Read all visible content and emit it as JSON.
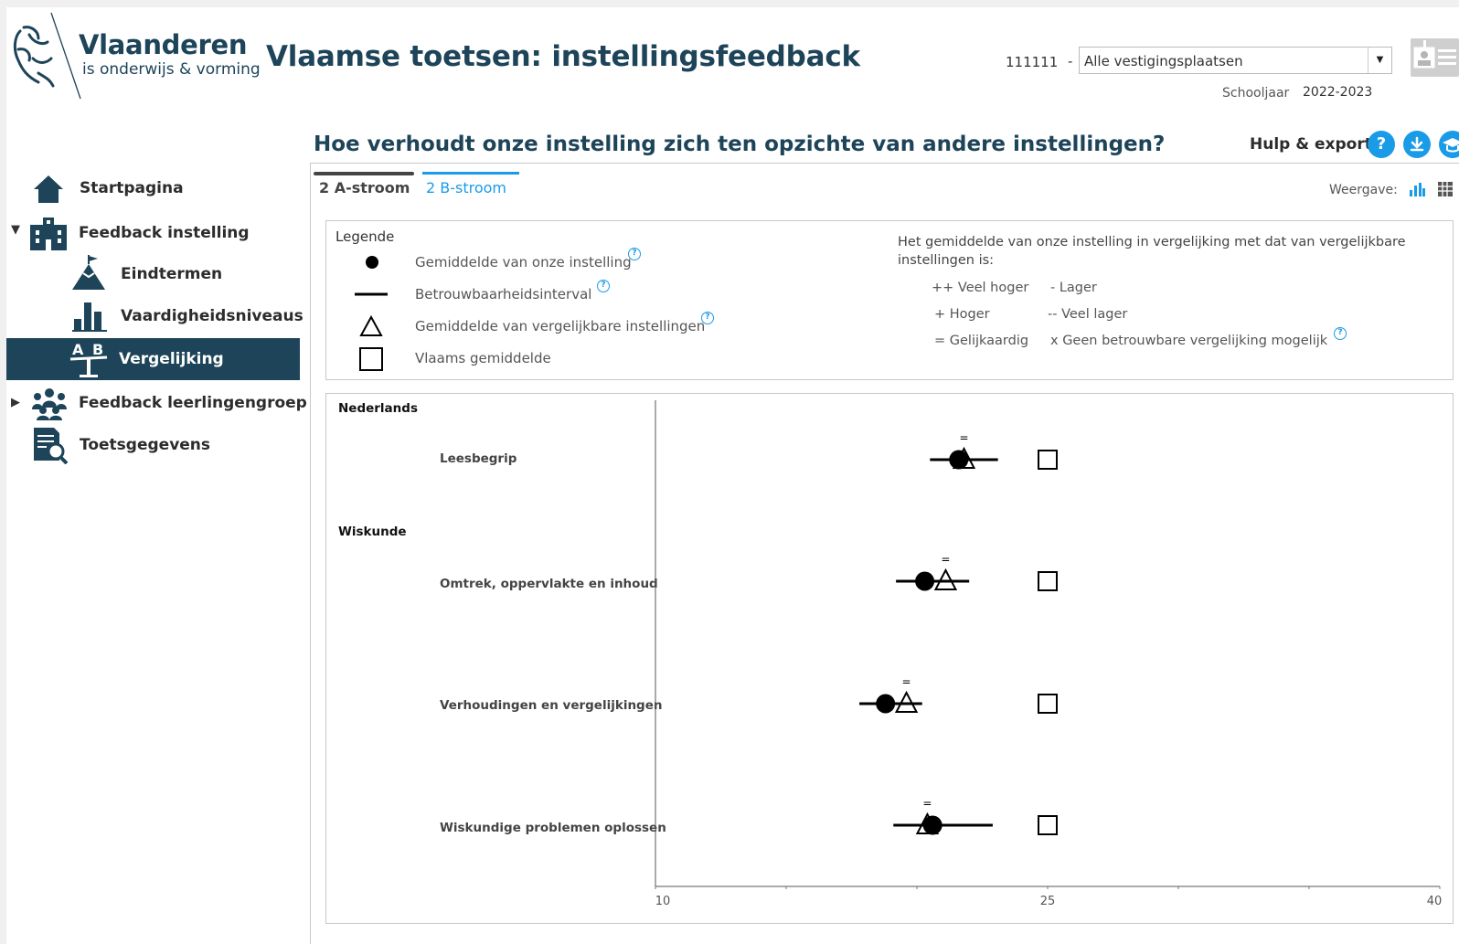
{
  "header": {
    "logo_title": "Vlaanderen",
    "logo_subtitle": "is onderwijs & vorming",
    "app_title": "Vlaamse toetsen: instellingsfeedback",
    "institution_code": "111111",
    "dash": "-",
    "location_select": "Alle vestigingsplaatsen",
    "schoolyear_label": "Schooljaar",
    "schoolyear_value": "2022-2023"
  },
  "sidebar": {
    "items": [
      {
        "label": "Startpagina",
        "icon": "home-icon"
      },
      {
        "label": "Feedback instelling",
        "icon": "school-building-icon",
        "expanded": true
      },
      {
        "label": "Eindtermen",
        "icon": "mountain-flag-icon"
      },
      {
        "label": "Vaardigheidsniveaus",
        "icon": "bar-chart-icon"
      },
      {
        "label": "Vergelijking",
        "icon": "seesaw-ab-icon",
        "active": true
      },
      {
        "label": "Feedback leerlingengroep",
        "icon": "people-group-icon",
        "expanded": false
      },
      {
        "label": "Toetsgegevens",
        "icon": "document-search-icon"
      }
    ]
  },
  "main": {
    "question": "Hoe verhoudt onze instelling zich ten opzichte van andere instellingen?",
    "help_label": "Hulp & export:",
    "help_buttons": [
      "help-icon",
      "download-icon",
      "graduation-cap-icon"
    ],
    "tabs": [
      {
        "label": "2 A-stroom",
        "active": false
      },
      {
        "label": "2 B-stroom",
        "active": true
      }
    ],
    "weergave_label": "Weergave:"
  },
  "legend": {
    "title": "Legende",
    "items": [
      {
        "label": "Gemiddelde van onze instelling",
        "symbol": "filled-circle"
      },
      {
        "label": "Betrouwbaarheidsinterval",
        "symbol": "line"
      },
      {
        "label": "Gemiddelde van vergelijkbare instellingen",
        "symbol": "triangle"
      },
      {
        "label": "Vlaams gemiddelde",
        "symbol": "square"
      }
    ],
    "comparison_title": "Het gemiddelde van onze instelling in vergelijking met dat van vergelijkbare instellingen is:",
    "comparison": [
      {
        "label": "++ Veel hoger"
      },
      {
        "label": "- Lager"
      },
      {
        "label": "+ Hoger"
      },
      {
        "label": "-- Veel lager"
      },
      {
        "label": "= Gelijkaardig"
      },
      {
        "label": "x Geen betrouwbare vergelijking mogelijk"
      }
    ]
  },
  "chart_data": {
    "type": "scatter",
    "x_range": [
      10,
      40
    ],
    "x_ticks": [
      "10",
      "25",
      "40"
    ],
    "groups": [
      {
        "category": "Nederlands",
        "rows": [
          {
            "label": "Leesbegrip",
            "own_mean": 21.6,
            "ci": [
              20.5,
              23.1
            ],
            "comparable_mean": 21.8,
            "flemish_mean": 25.0,
            "comparison": "="
          }
        ]
      },
      {
        "category": "Wiskunde",
        "rows": [
          {
            "label": "Omtrek, oppervlakte en inhoud",
            "own_mean": 20.3,
            "ci": [
              19.2,
              22.0
            ],
            "comparable_mean": 21.1,
            "flemish_mean": 25.0,
            "comparison": "="
          },
          {
            "label": "Verhoudingen en vergelijkingen",
            "own_mean": 18.8,
            "ci": [
              17.8,
              20.2
            ],
            "comparable_mean": 19.6,
            "flemish_mean": 25.0,
            "comparison": "="
          },
          {
            "label": "Wiskundige problemen oplossen",
            "own_mean": 20.6,
            "ci": [
              19.1,
              22.9
            ],
            "comparable_mean": 20.4,
            "flemish_mean": 25.0,
            "comparison": "="
          }
        ]
      }
    ]
  }
}
